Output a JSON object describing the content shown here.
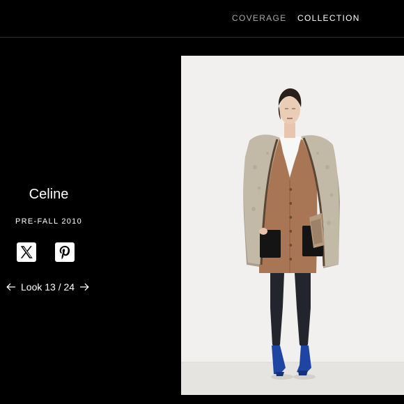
{
  "nav": {
    "coverage_label": "COVERAGE",
    "collection_label": "COLLECTION",
    "active": "COLLECTION"
  },
  "info": {
    "designer": "Celine",
    "season": "PRE-FALL 2010",
    "look_label": "Look 13 / 24"
  },
  "social": {
    "icons": [
      "x-icon",
      "pinterest-icon"
    ]
  },
  "colors": {
    "background": "#000000",
    "text": "#ffffff",
    "nav_inactive": "#a9a9a9",
    "photo_background": "#f1f0ee"
  }
}
